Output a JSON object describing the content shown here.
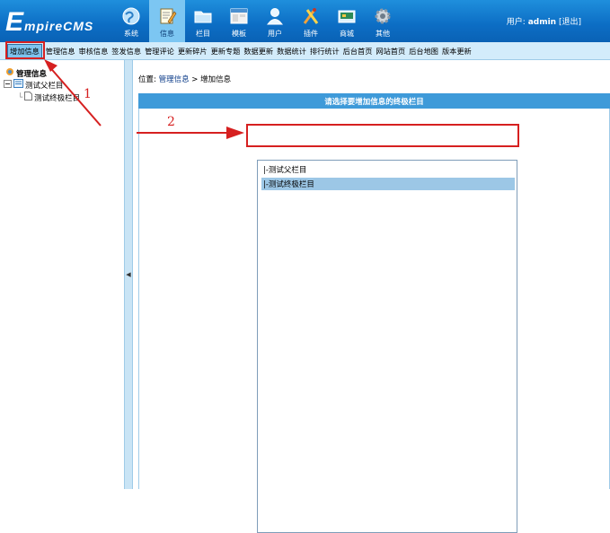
{
  "header": {
    "logo_big": "E",
    "logo_rest": "mpireCMS",
    "nav": [
      {
        "label": "系统",
        "icon": "globe-icon",
        "active": false
      },
      {
        "label": "信息",
        "icon": "document-edit-icon",
        "active": true
      },
      {
        "label": "栏目",
        "icon": "folder-icon",
        "active": false
      },
      {
        "label": "模板",
        "icon": "window-template-icon",
        "active": false
      },
      {
        "label": "用户",
        "icon": "user-icon",
        "active": false
      },
      {
        "label": "插件",
        "icon": "tools-icon",
        "active": false
      },
      {
        "label": "商城",
        "icon": "shop-icon",
        "active": false
      },
      {
        "label": "其他",
        "icon": "gear-icon",
        "active": false
      }
    ],
    "user_label": "用户:",
    "user_name": "admin",
    "logout": "[退出]"
  },
  "submenu": [
    "增加信息",
    "管理信息",
    "审核信息",
    "签发信息",
    "管理评论",
    "更新碎片",
    "更新专题",
    "数据更新",
    "数据统计",
    "排行统计",
    "后台首页",
    "网站首页",
    "后台地图",
    "版本更新"
  ],
  "tree": {
    "root": "管理信息",
    "parent": "测试父栏目",
    "child": "测试终极栏目"
  },
  "main": {
    "location_prefix": "位置:",
    "location_link": "管理信息",
    "location_sep": ">",
    "location_current": "增加信息",
    "panel_title": "请选择要增加信息的终极栏目",
    "options": [
      "|-测试父栏目",
      "|-测试终极栏目"
    ]
  },
  "annotations": {
    "num1": "1",
    "num2": "2",
    "color": "#d62020"
  }
}
